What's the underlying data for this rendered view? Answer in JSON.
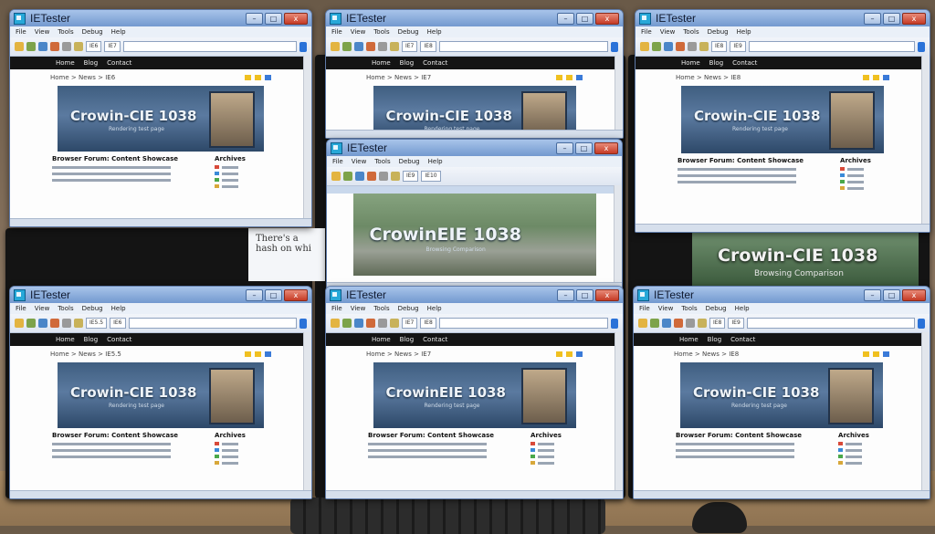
{
  "photo": {
    "background_windows": {
      "doc_text": "There's a hash on whi",
      "photo_title": "Crowin-CIE 1038",
      "photo_sub": "Browsing Comparison"
    }
  },
  "windows": [
    {
      "title": "IETester",
      "menu": [
        "File",
        "View",
        "Tools",
        "Debug",
        "Help"
      ],
      "dropdowns": [
        "IE6",
        "IE7"
      ],
      "nav": [
        "Home",
        "Blog",
        "Contact"
      ],
      "breadcrumb": "Home > News > IE6",
      "hero_title": "Crowin-CIE 1038",
      "hero_sub": "Rendering test page",
      "article_title": "Browser Forum: Content Showcase",
      "side_title": "Archives"
    },
    {
      "title": "IETester",
      "menu": [
        "File",
        "View",
        "Tools",
        "Debug",
        "Help"
      ],
      "dropdowns": [
        "IE7",
        "IE8"
      ],
      "nav": [
        "Home",
        "Blog",
        "Contact"
      ],
      "breadcrumb": "Home > News > IE7",
      "hero_title": "Crowin-CIE 1038",
      "hero_sub": "Rendering test page",
      "article_title": "",
      "side_title": ""
    },
    {
      "title": "IETester",
      "menu": [
        "File",
        "View",
        "Tools",
        "Debug",
        "Help"
      ],
      "dropdowns": [
        "IE8",
        "IE9"
      ],
      "nav": [
        "Home",
        "Blog",
        "Contact"
      ],
      "breadcrumb": "Home > News > IE8",
      "hero_title": "Crowin-CIE 1038",
      "hero_sub": "Rendering test page",
      "article_title": "Browser Forum: Content Showcase",
      "side_title": "Archives"
    },
    {
      "title": "IETester",
      "menu": [
        "File",
        "View",
        "Tools",
        "Debug",
        "Help"
      ],
      "dropdowns": [
        "IE9",
        "IE10"
      ],
      "nav": [],
      "breadcrumb": "",
      "hero_title": "CrowinEIE 1038",
      "hero_sub": "Browsing Comparison",
      "article_title": "",
      "side_title": ""
    },
    {
      "title": "IETester",
      "menu": [
        "File",
        "View",
        "Tools",
        "Debug",
        "Help"
      ],
      "dropdowns": [
        "IE5.5",
        "IE6"
      ],
      "nav": [
        "Home",
        "Blog",
        "Contact"
      ],
      "breadcrumb": "Home > News > IE5.5",
      "hero_title": "Crowin-CIE 1038",
      "hero_sub": "Rendering test page",
      "article_title": "Browser Forum: Content Showcase",
      "side_title": "Archives"
    },
    {
      "title": "IETester",
      "menu": [
        "File",
        "View",
        "Tools",
        "Debug",
        "Help"
      ],
      "dropdowns": [
        "IE7",
        "IE8"
      ],
      "nav": [
        "Home",
        "Blog",
        "Contact"
      ],
      "breadcrumb": "Home > News > IE7",
      "hero_title": "CrowinEIE 1038",
      "hero_sub": "Rendering test page",
      "article_title": "Browser Forum: Content Showcase",
      "side_title": "Archives"
    },
    {
      "title": "IETester",
      "menu": [
        "File",
        "View",
        "Tools",
        "Debug",
        "Help"
      ],
      "dropdowns": [
        "IE8",
        "IE9"
      ],
      "nav": [
        "Home",
        "Blog",
        "Contact"
      ],
      "breadcrumb": "Home > News > IE8",
      "hero_title": "Crowin-CIE 1038",
      "hero_sub": "Rendering test page",
      "article_title": "Browser Forum: Content Showcase",
      "side_title": "Archives"
    }
  ],
  "window_controls": {
    "minimize": "–",
    "maximize": "□",
    "close": "x"
  },
  "accent_colors": {
    "titlebar": "#7399cf",
    "go_button": "#2a72d8",
    "close": "#c53a25"
  }
}
